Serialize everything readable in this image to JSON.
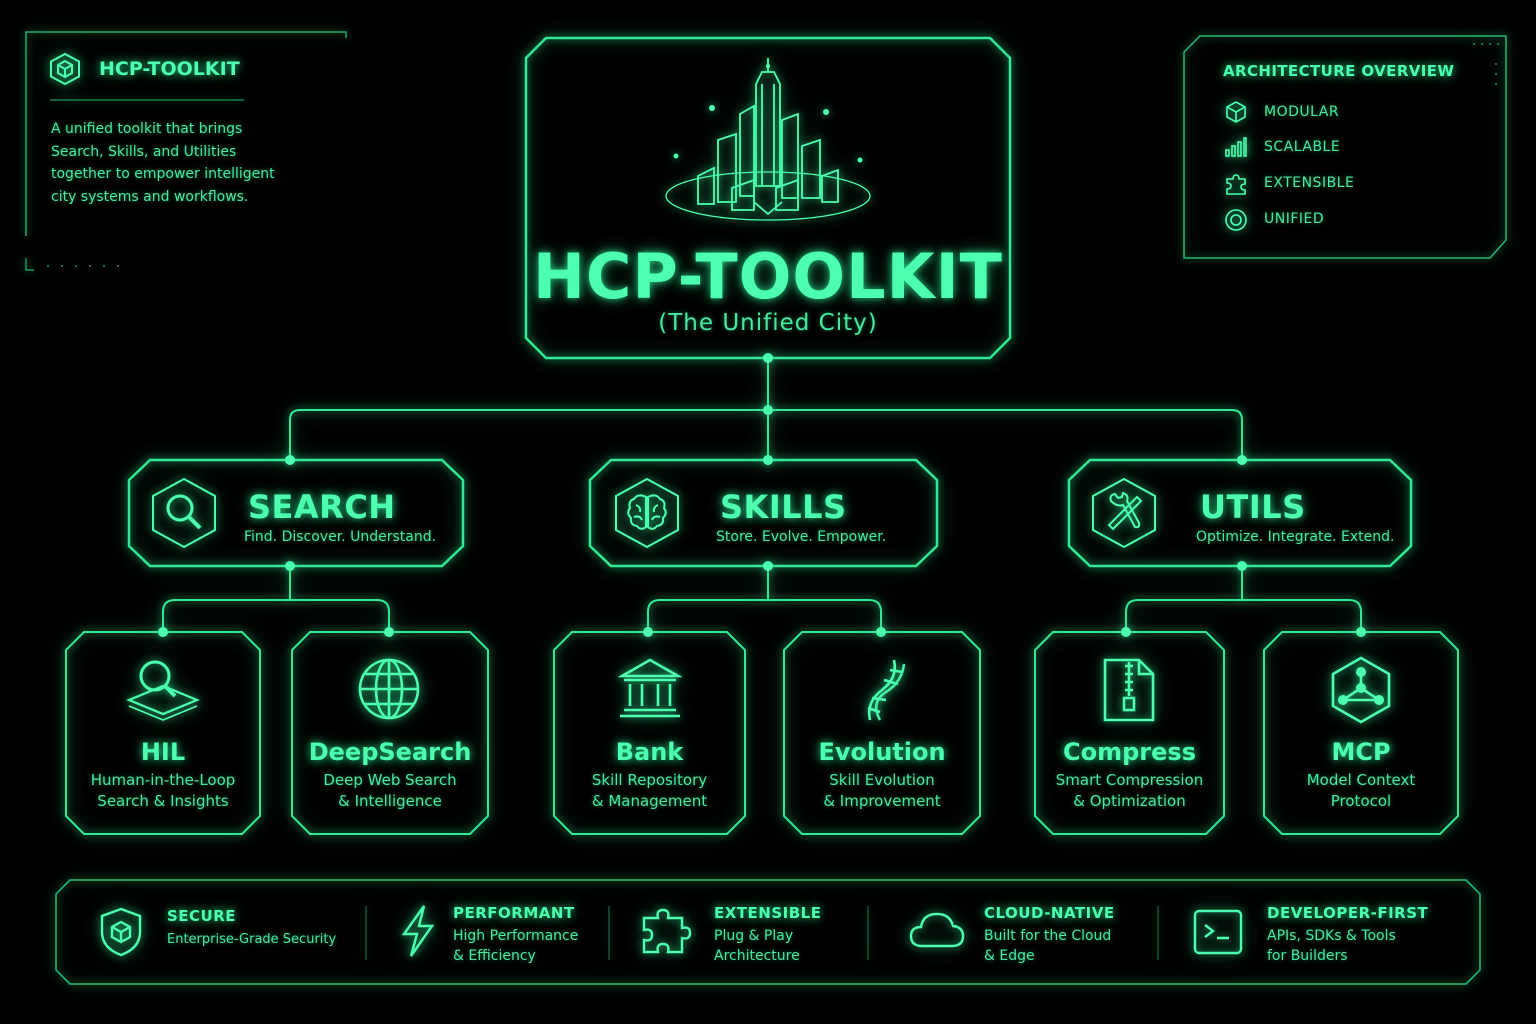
{
  "info_panel": {
    "title": "HCP-TOOLKIT",
    "description_lines": [
      "A unified toolkit that brings",
      "Search, Skills, and Utilities",
      "together to empower intelligent",
      "city systems and workflows."
    ],
    "icon": "cube-icon"
  },
  "overview_panel": {
    "title": "ARCHITECTURE OVERVIEW",
    "items": [
      {
        "label": "MODULAR",
        "icon": "cube-icon"
      },
      {
        "label": "SCALABLE",
        "icon": "bar-chart-icon"
      },
      {
        "label": "EXTENSIBLE",
        "icon": "puzzle-icon"
      },
      {
        "label": "UNIFIED",
        "icon": "target-icon"
      }
    ]
  },
  "root": {
    "title": "HCP-TOOLKIT",
    "subtitle": "(The Unified City)",
    "icon": "city-skyline-icon"
  },
  "categories": [
    {
      "title": "SEARCH",
      "tagline": "Find. Discover. Understand.",
      "icon": "magnifier-icon"
    },
    {
      "title": "SKILLS",
      "tagline": "Store. Evolve. Empower.",
      "icon": "brain-icon"
    },
    {
      "title": "UTILS",
      "tagline": "Optimize. Integrate. Extend.",
      "icon": "tools-icon"
    }
  ],
  "leaves": [
    {
      "title": "HIL",
      "desc1": "Human-in-the-Loop",
      "desc2": "Search & Insights",
      "icon": "search-layer-icon"
    },
    {
      "title": "DeepSearch",
      "desc1": "Deep Web Search",
      "desc2": "& Intelligence",
      "icon": "globe-icon"
    },
    {
      "title": "Bank",
      "desc1": "Skill Repository",
      "desc2": "& Management",
      "icon": "bank-icon"
    },
    {
      "title": "Evolution",
      "desc1": "Skill Evolution",
      "desc2": "& Improvement",
      "icon": "dna-icon"
    },
    {
      "title": "Compress",
      "desc1": "Smart Compression",
      "desc2": "& Optimization",
      "icon": "zip-file-icon"
    },
    {
      "title": "MCP",
      "desc1": "Model Context",
      "desc2": "Protocol",
      "icon": "network-hexagon-icon"
    }
  ],
  "features": [
    {
      "title": "SECURE",
      "desc1": "Enterprise-Grade Security",
      "desc2": "",
      "icon": "shield-icon"
    },
    {
      "title": "PERFORMANT",
      "desc1": "High Performance",
      "desc2": "& Efficiency",
      "icon": "lightning-icon"
    },
    {
      "title": "EXTENSIBLE",
      "desc1": "Plug & Play",
      "desc2": "Architecture",
      "icon": "puzzle-icon"
    },
    {
      "title": "CLOUD-NATIVE",
      "desc1": "Built for the Cloud",
      "desc2": "& Edge",
      "icon": "cloud-icon"
    },
    {
      "title": "DEVELOPER-FIRST",
      "desc1": "APIs, SDKs & Tools",
      "desc2": "for Builders",
      "icon": "terminal-icon"
    }
  ],
  "colors": {
    "accent": "#3df2a0",
    "background": "#000000"
  }
}
